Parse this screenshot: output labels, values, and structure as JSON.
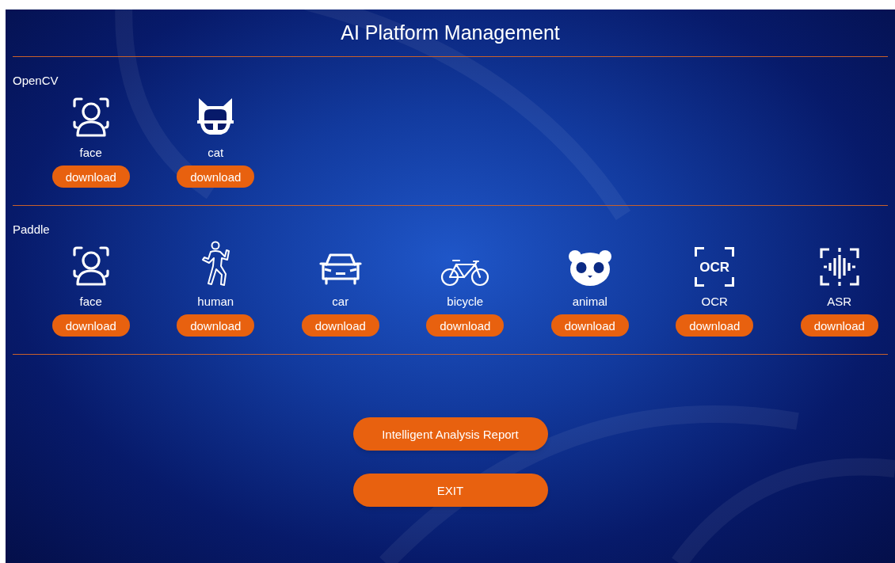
{
  "title": "AI Platform Management",
  "sections": [
    {
      "label": "OpenCV",
      "items": [
        {
          "kind": "face",
          "label": "face",
          "button": "download"
        },
        {
          "kind": "cat",
          "label": "cat",
          "button": "download"
        }
      ]
    },
    {
      "label": "Paddle",
      "items": [
        {
          "kind": "face",
          "label": "face",
          "button": "download"
        },
        {
          "kind": "human",
          "label": "human",
          "button": "download"
        },
        {
          "kind": "car",
          "label": "car",
          "button": "download"
        },
        {
          "kind": "bicycle",
          "label": "bicycle",
          "button": "download"
        },
        {
          "kind": "panda",
          "label": "animal",
          "button": "download"
        },
        {
          "kind": "ocr",
          "label": "OCR",
          "button": "download",
          "icon_text": "OCR"
        },
        {
          "kind": "asr",
          "label": "ASR",
          "button": "download"
        }
      ]
    }
  ],
  "buttons": [
    "Intelligent Analysis Report",
    "EXIT"
  ]
}
